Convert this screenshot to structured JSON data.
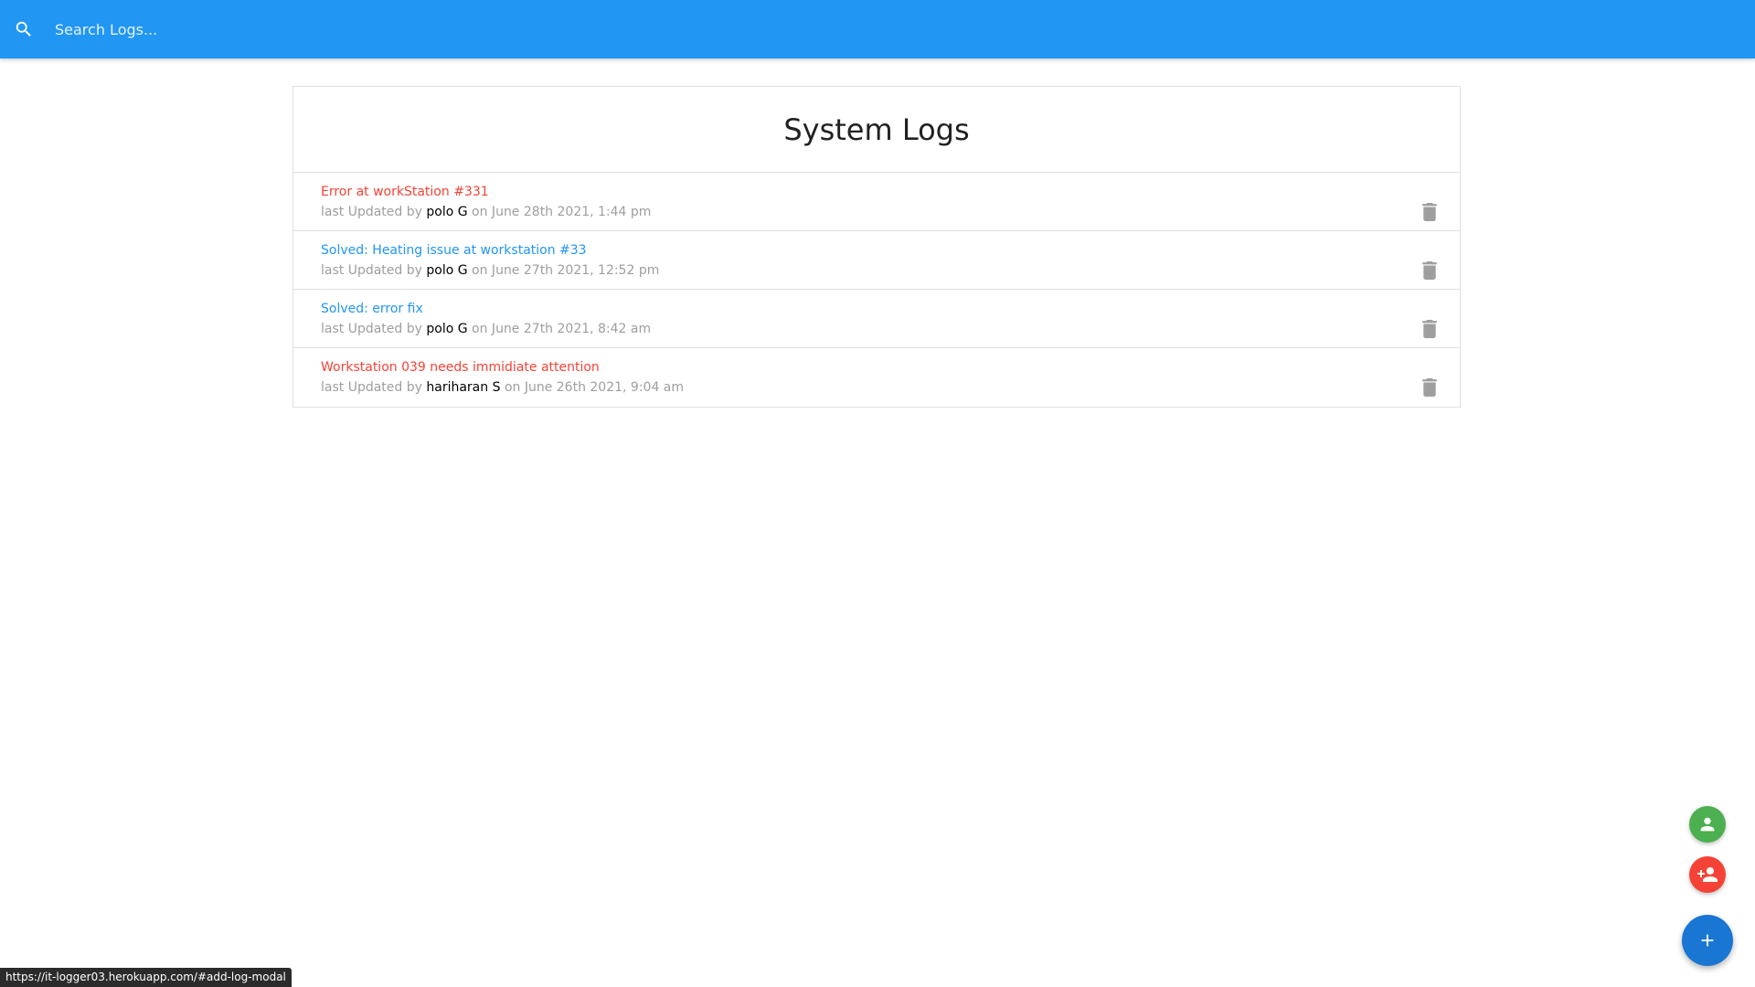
{
  "colors": {
    "navbar": "#2196f3",
    "attention": "#f44336",
    "normal": "#2196f3",
    "meta": "#9e9e9e",
    "tech": "#000000",
    "fab_tech": "#4caf50",
    "fab_add_tech": "#f44336",
    "fab_add_log": "#1976d2"
  },
  "search": {
    "icon": "search-icon",
    "placeholder": "Search Logs..."
  },
  "logs": {
    "header": "System Logs",
    "items": [
      {
        "message": "Error at workStation #331",
        "attention": true,
        "prefix": "last Updated by",
        "tech": "polo G",
        "date": "on June 28th 2021, 1:44 pm"
      },
      {
        "message": "Solved: Heating issue at workstation #33",
        "attention": false,
        "prefix": "last Updated by",
        "tech": "polo G",
        "date": "on June 27th 2021, 12:52 pm"
      },
      {
        "message": "Solved: error fix",
        "attention": false,
        "prefix": "last Updated by",
        "tech": "polo G",
        "date": "on June 27th 2021, 8:42 am"
      },
      {
        "message": "Workstation 039 needs immidiate attention",
        "attention": true,
        "prefix": "last Updated by",
        "tech": "hariharan S",
        "date": "on June 26th 2021, 9:04 am"
      }
    ]
  },
  "fabs": {
    "tech_list_icon": "person-icon",
    "add_tech_icon": "person-add-icon",
    "add_log_icon": "plus-icon"
  },
  "status_bar": {
    "url": "https://it-logger03.herokuapp.com/#add-log-modal"
  }
}
